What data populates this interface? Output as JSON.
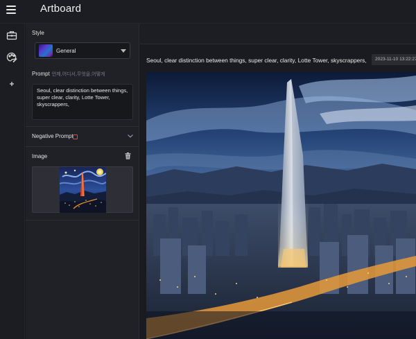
{
  "header": {
    "title": "Artboard"
  },
  "rail": {
    "icons": [
      "toolbox-icon",
      "palette-icon",
      "plus-icon"
    ]
  },
  "panel": {
    "style_label": "Style",
    "style_value": "General",
    "prompt_label": "Prompt",
    "prompt_hint": "언제,어디서,무엇을,어떻게",
    "prompt_text": "Seoul, clear distinction between things, super clear, clarity, Lotte Tower, skyscrappers,",
    "negative_prompt_label": "Negative Prompt",
    "image_label": "Image"
  },
  "result": {
    "caption": "Seoul, clear distinction between things, super clear, clarity, Lotte Tower, skyscrappers,",
    "timestamp": "2023-11-10 13:22:27"
  },
  "colors": {
    "accent_negative": "#e04848",
    "background": "#1a1b20",
    "panel": "#202127"
  }
}
